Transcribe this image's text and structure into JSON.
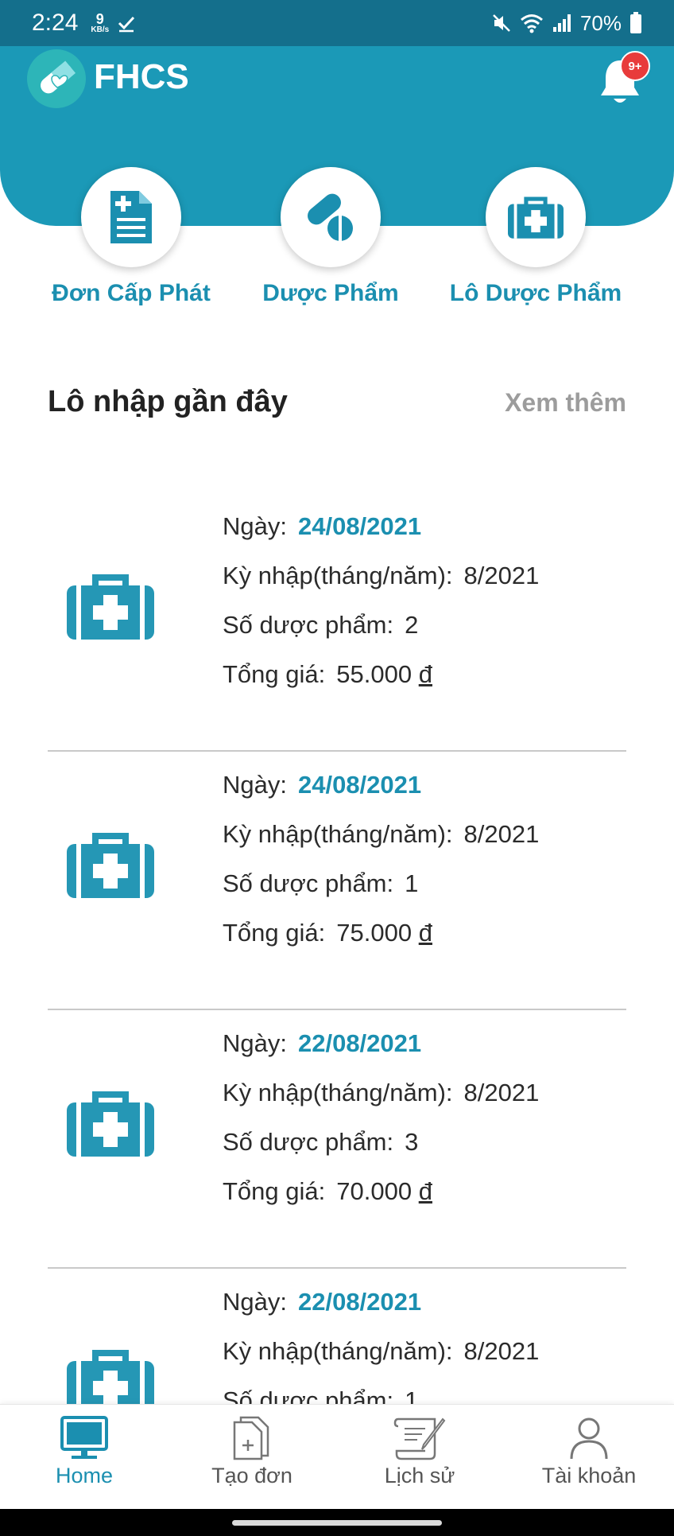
{
  "status": {
    "time": "2:24",
    "net_speed": "9",
    "net_unit": "KB/s",
    "battery": "70%"
  },
  "header": {
    "app_name": "FHCS",
    "notification_badge": "9+"
  },
  "actions": [
    {
      "label": "Đơn Cấp Phát"
    },
    {
      "label": "Dược Phẩm"
    },
    {
      "label": "Lô Dược Phẩm"
    }
  ],
  "recent": {
    "title": "Lô nhập gần đây",
    "see_more": "Xem thêm",
    "labels": {
      "date": "Ngày:",
      "period": "Kỳ nhập(tháng/năm):",
      "count": "Số dược phẩm:",
      "total": "Tổng giá:"
    },
    "currency": "đ",
    "items": [
      {
        "date": "24/08/2021",
        "period": "8/2021",
        "count": "2",
        "total": "55.000"
      },
      {
        "date": "24/08/2021",
        "period": "8/2021",
        "count": "1",
        "total": "75.000"
      },
      {
        "date": "22/08/2021",
        "period": "8/2021",
        "count": "3",
        "total": "70.000"
      },
      {
        "date": "22/08/2021",
        "period": "8/2021",
        "count": "1",
        "total": ""
      }
    ]
  },
  "nav": [
    {
      "label": "Home",
      "icon": "monitor-icon"
    },
    {
      "label": "Tạo đơn",
      "icon": "new-document-icon"
    },
    {
      "label": "Lịch sử",
      "icon": "scroll-history-icon"
    },
    {
      "label": "Tài khoản",
      "icon": "user-icon"
    }
  ],
  "colors": {
    "primary": "#1b99b7",
    "status_bar": "#146f8c",
    "accent_text": "#1b8fb0",
    "badge": "#e83b3b"
  }
}
